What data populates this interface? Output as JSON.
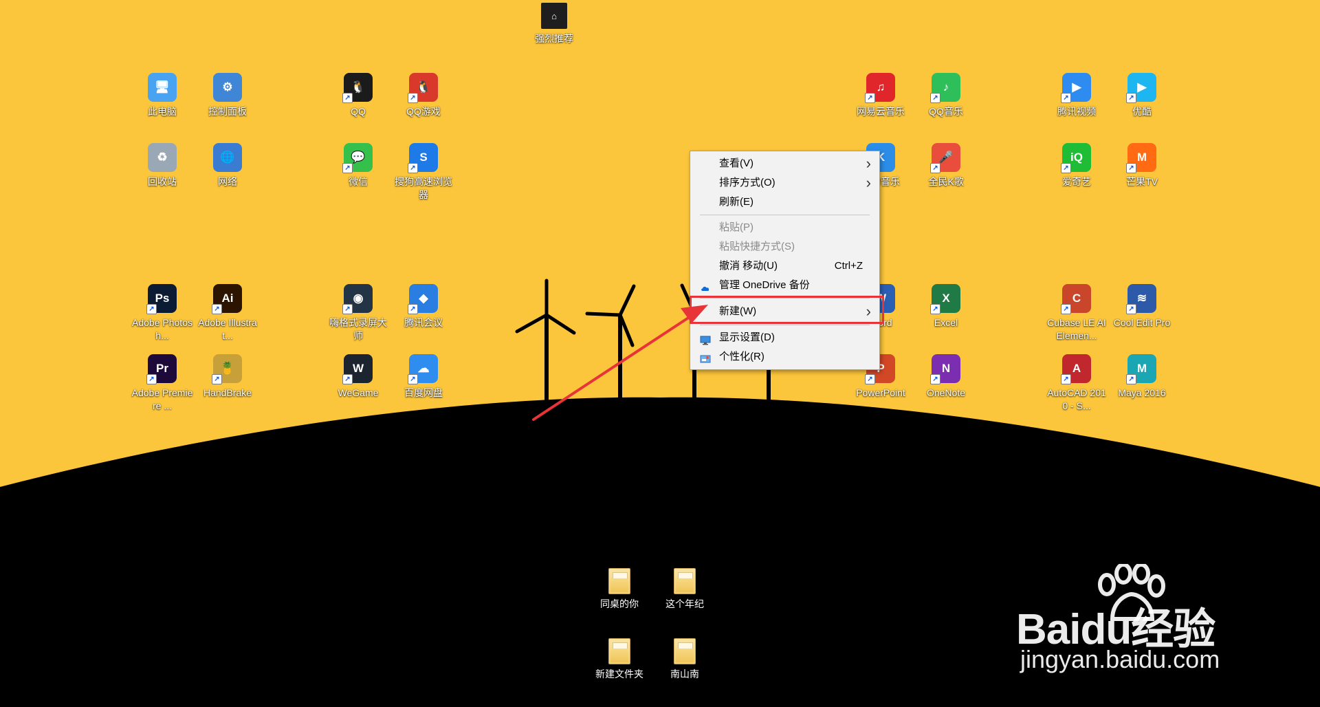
{
  "colors": {
    "wallpaper_sky": "#fcc63c",
    "wallpaper_hill": "#000000",
    "menu_bg": "#f2f2f2",
    "highlight": "#e83339",
    "arrow": "#e83339"
  },
  "top_app": {
    "label": "强烈推荐",
    "icon": "recommend-icon"
  },
  "desktop_icons": [
    {
      "id": "this-pc",
      "label": "此电脑",
      "icon": "computer-icon",
      "glyph": "🖥",
      "color": "#4aa3f0",
      "shortcut": false
    },
    {
      "id": "control-panel",
      "label": "控制面板",
      "icon": "control-panel-icon",
      "glyph": "⚙",
      "color": "#3f86d6",
      "shortcut": false
    },
    {
      "id": "qq",
      "label": "QQ",
      "icon": "qq-penguin-icon",
      "glyph": "🐧",
      "color": "#1b1b1b",
      "shortcut": true
    },
    {
      "id": "qq-game",
      "label": "QQ游戏",
      "icon": "qq-game-icon",
      "glyph": "🐧",
      "color": "#d8392b",
      "shortcut": true
    },
    {
      "id": "netease-music",
      "label": "网易云音乐",
      "icon": "netease-music-icon",
      "glyph": "♫",
      "color": "#e0262a",
      "shortcut": true
    },
    {
      "id": "qq-music",
      "label": "QQ音乐",
      "icon": "qq-music-icon",
      "glyph": "♪",
      "color": "#2fbf5a",
      "shortcut": true
    },
    {
      "id": "tencent-video",
      "label": "腾讯视频",
      "icon": "tencent-video-icon",
      "glyph": "▶",
      "color": "#2e8cf0",
      "shortcut": true
    },
    {
      "id": "youku",
      "label": "优酷",
      "icon": "youku-icon",
      "glyph": "▶",
      "color": "#1eb6f0",
      "shortcut": true
    },
    {
      "id": "recycle-bin",
      "label": "回收站",
      "icon": "recycle-bin-icon",
      "glyph": "♻",
      "color": "#9aa7b5",
      "shortcut": false
    },
    {
      "id": "network",
      "label": "网络",
      "icon": "network-icon",
      "glyph": "🌐",
      "color": "#3a7cd1",
      "shortcut": false
    },
    {
      "id": "wechat",
      "label": "微信",
      "icon": "wechat-icon",
      "glyph": "💬",
      "color": "#35c04b",
      "shortcut": true
    },
    {
      "id": "sogou-browser",
      "label": "搜狗高速浏览器",
      "icon": "sogou-browser-icon",
      "glyph": "S",
      "color": "#1e7ae6",
      "shortcut": true
    },
    {
      "id": "kugou",
      "label": "酷狗音乐",
      "icon": "kugou-icon",
      "glyph": "K",
      "color": "#2b8de8",
      "shortcut": true
    },
    {
      "id": "quanmin-k",
      "label": "全民K歌",
      "icon": "quanmin-k-icon",
      "glyph": "🎤",
      "color": "#e94e3c",
      "shortcut": true
    },
    {
      "id": "iqiyi",
      "label": "爱奇艺",
      "icon": "iqiyi-icon",
      "glyph": "iQ",
      "color": "#1fbd36",
      "shortcut": true
    },
    {
      "id": "mango-tv",
      "label": "芒果TV",
      "icon": "mango-tv-icon",
      "glyph": "M",
      "color": "#ff6a12",
      "shortcut": true
    },
    {
      "id": "photoshop",
      "label": "Adobe Photosh...",
      "icon": "photoshop-icon",
      "glyph": "Ps",
      "color": "#0b1b33",
      "shortcut": true
    },
    {
      "id": "illustrator",
      "label": "Adobe Illustrat...",
      "icon": "illustrator-icon",
      "glyph": "Ai",
      "color": "#2d1400",
      "shortcut": true
    },
    {
      "id": "screen-recorder",
      "label": "嗨格式录屏大师",
      "icon": "screen-recorder-icon",
      "glyph": "◉",
      "color": "#243447",
      "shortcut": true
    },
    {
      "id": "tencent-meeting",
      "label": "腾讯会议",
      "icon": "tencent-meeting-icon",
      "glyph": "◆",
      "color": "#2a7de1",
      "shortcut": true
    },
    {
      "id": "word",
      "label": "Word",
      "icon": "word-icon",
      "glyph": "W",
      "color": "#2b5fb4",
      "shortcut": true
    },
    {
      "id": "excel",
      "label": "Excel",
      "icon": "excel-icon",
      "glyph": "X",
      "color": "#1f7a45",
      "shortcut": true
    },
    {
      "id": "cubase",
      "label": "Cubase LE AI Elemen...",
      "icon": "cubase-icon",
      "glyph": "C",
      "color": "#c9462a",
      "shortcut": true
    },
    {
      "id": "cool-edit",
      "label": "Cool Edit Pro",
      "icon": "cool-edit-icon",
      "glyph": "≋",
      "color": "#2d5aa8",
      "shortcut": true
    },
    {
      "id": "premiere",
      "label": "Adobe Premiere ...",
      "icon": "premiere-icon",
      "glyph": "Pr",
      "color": "#1e0a3a",
      "shortcut": true
    },
    {
      "id": "handbrake",
      "label": "HandBrake",
      "icon": "handbrake-icon",
      "glyph": "🍍",
      "color": "#c8a03a",
      "shortcut": true
    },
    {
      "id": "wegame",
      "label": "WeGame",
      "icon": "wegame-icon",
      "glyph": "W",
      "color": "#1c2430",
      "shortcut": true
    },
    {
      "id": "baidu-pan",
      "label": "百度网盘",
      "icon": "baidu-pan-icon",
      "glyph": "☁",
      "color": "#2f8df0",
      "shortcut": true
    },
    {
      "id": "powerpoint",
      "label": "PowerPoint",
      "icon": "powerpoint-icon",
      "glyph": "P",
      "color": "#d24726",
      "shortcut": true
    },
    {
      "id": "onenote",
      "label": "OneNote",
      "icon": "onenote-icon",
      "glyph": "N",
      "color": "#7b2fb0",
      "shortcut": true
    },
    {
      "id": "autocad",
      "label": "AutoCAD 2010 - S...",
      "icon": "autocad-icon",
      "glyph": "A",
      "color": "#c0282d",
      "shortcut": true
    },
    {
      "id": "maya",
      "label": "Maya 2016",
      "icon": "maya-icon",
      "glyph": "M",
      "color": "#1aa7b3",
      "shortcut": true
    }
  ],
  "folders": [
    {
      "id": "folder-tongzhuo",
      "label": "同桌的你"
    },
    {
      "id": "folder-zhege-nianji",
      "label": "这个年纪"
    },
    {
      "id": "folder-new",
      "label": "新建文件夹"
    },
    {
      "id": "folder-nanshannan",
      "label": "南山南"
    }
  ],
  "context_menu": {
    "items": [
      {
        "id": "view",
        "label": "查看(V)",
        "submenu": true,
        "disabled": false
      },
      {
        "id": "sort",
        "label": "排序方式(O)",
        "submenu": true,
        "disabled": false
      },
      {
        "id": "refresh",
        "label": "刷新(E)",
        "submenu": false,
        "disabled": false
      },
      {
        "separator": true
      },
      {
        "id": "paste",
        "label": "粘贴(P)",
        "submenu": false,
        "disabled": true
      },
      {
        "id": "paste-shortcut",
        "label": "粘贴快捷方式(S)",
        "submenu": false,
        "disabled": true
      },
      {
        "id": "undo-move",
        "label": "撤消 移动(U)",
        "accel": "Ctrl+Z",
        "submenu": false,
        "disabled": false
      },
      {
        "id": "onedrive",
        "label": "管理 OneDrive 备份",
        "icon": "onedrive-cloud-icon",
        "submenu": false,
        "disabled": false
      },
      {
        "separator": true
      },
      {
        "id": "new",
        "label": "新建(W)",
        "submenu": true,
        "disabled": false,
        "highlighted": true
      },
      {
        "separator": true
      },
      {
        "id": "display-settings",
        "label": "显示设置(D)",
        "icon": "display-settings-icon",
        "submenu": false,
        "disabled": false
      },
      {
        "id": "personalize",
        "label": "个性化(R)",
        "icon": "personalize-icon",
        "submenu": false,
        "disabled": false
      }
    ]
  },
  "watermark": {
    "brand": "Baidu经验",
    "url": "jingyan.baidu.com",
    "icon": "baidu-paw-icon"
  }
}
